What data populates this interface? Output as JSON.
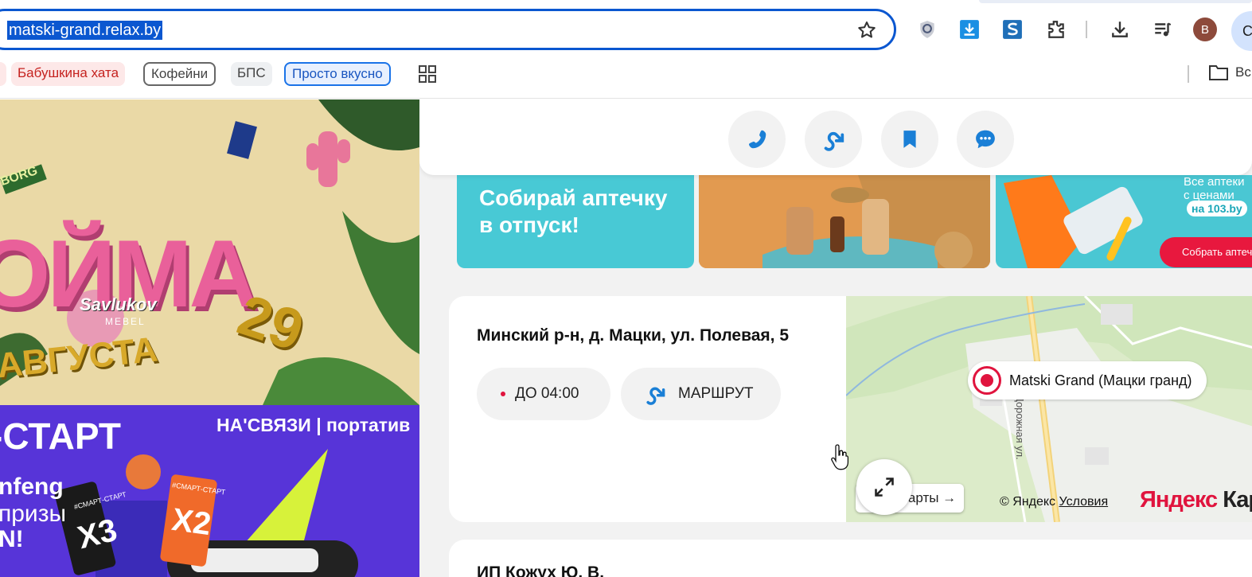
{
  "browser": {
    "url": "matski-grand.relax.by",
    "toolbar_icons": [
      "shield-extension-icon",
      "download-extension-icon",
      "s-extension-icon",
      "puzzle-extensions-icon",
      "downloads-icon",
      "media-playlist-icon"
    ],
    "profile_initial": "B",
    "profile2_initial": "C"
  },
  "bookmarks": {
    "items": [
      "Бабушкина хата",
      "Кофейни",
      "БПС",
      "Просто вкусно"
    ],
    "folder_label": "Вс"
  },
  "ads": {
    "ad1_title": "ОЙМА",
    "ad1_date_num": "29",
    "ad1_date_month": "АВГУСТА",
    "ad1_brand": "Savlukov",
    "ad1_brand_sub": "MEBEL",
    "ad1_corner": "BORG",
    "ad2_title": "-СТАРТ",
    "ad2_tagline": "НА'СВЯЗИ | портатив",
    "ad2_line1": "nfeng",
    "ad2_line2": "призы",
    "ad2_line3": "N!",
    "ad2_ticket1": "X3",
    "ad2_ticket2": "X2",
    "ad2_ticket_label": "#СМАРТ-СТАРТ"
  },
  "actions": {
    "buttons": [
      "phone-icon",
      "route-icon",
      "bookmark-icon",
      "chat-icon"
    ]
  },
  "banner": {
    "headline_line1": "Собирай аптечку",
    "headline_line2": "в отпуск!",
    "side_text_line1": "Все аптеки",
    "side_text_line2": "с ценами",
    "side_pill": "на 103.by",
    "cta": "Собрать аптечку"
  },
  "place": {
    "address": "Минский р-н, д. Мацки, ул. Полевая, 5",
    "hours": "ДО 04:00",
    "hours_dot_color": "#e0143e",
    "route_label": "МАРШРУТ"
  },
  "map": {
    "pin_label": "Matski Grand (Мацки гранд)",
    "road_label": "Дорожная ул.",
    "maps_link": "Карты →",
    "copyright": "© Яндекс",
    "terms": "Условия",
    "logo_red": "Яндекс",
    "logo_dark": "Кар"
  },
  "next_card": {
    "title": "ИП Кожух Ю. В."
  }
}
